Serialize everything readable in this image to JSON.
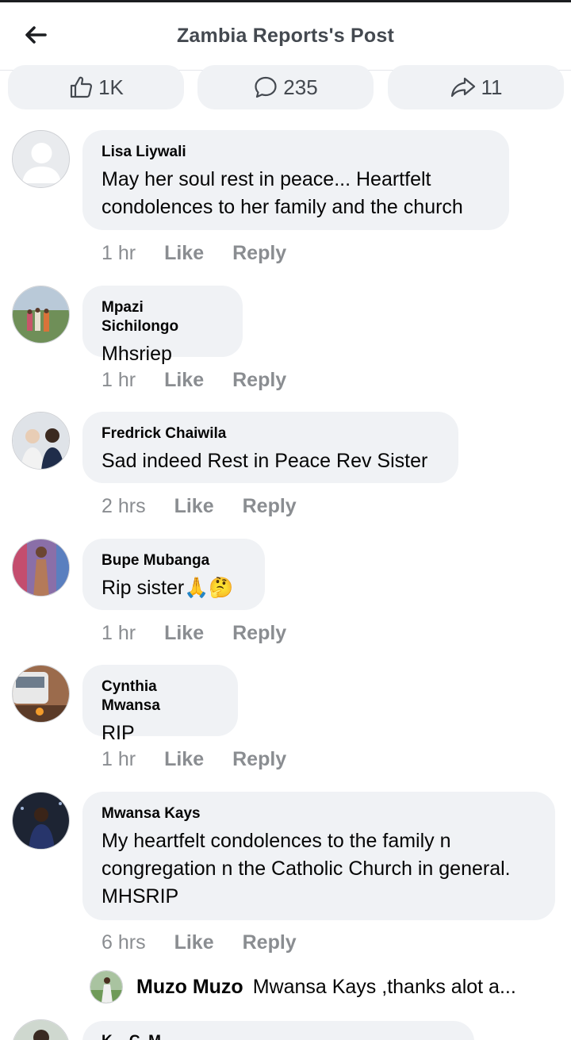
{
  "header": {
    "title": "Zambia Reports's Post",
    "back_icon": "arrow-left-icon"
  },
  "stats": {
    "likes": "1K",
    "comments": "235",
    "shares": "11",
    "like_icon": "thumbs-up-icon",
    "comment_icon": "comment-bubble-icon",
    "share_icon": "share-arrow-icon"
  },
  "actions": {
    "like": "Like",
    "reply": "Reply"
  },
  "comments": [
    {
      "name": "Lisa Liywali",
      "text": "May her soul rest in peace... Heartfelt\ncondolences to her family and the church",
      "time": "1 hr"
    },
    {
      "name": "Mpazi Sichilongo",
      "text": "Mhsriep",
      "time": "1 hr"
    },
    {
      "name": "Fredrick Chaiwila",
      "text": "Sad indeed Rest in Peace Rev Sister",
      "time": "2 hrs"
    },
    {
      "name": "Bupe Mubanga",
      "text": "Rip sister",
      "emoji": "🙏🤔",
      "time": "1 hr"
    },
    {
      "name": "Cynthia Mwansa",
      "text": "RIP",
      "time": "1 hr"
    },
    {
      "name": "Mwansa Kays",
      "text": "My heartfelt condolences to the family n\ncongregation n the Catholic Church in general.\nMHSRIP",
      "time": "6 hrs"
    }
  ],
  "reply_preview": {
    "name": "Muzo Muzo",
    "text": "Mwansa Kays ,thanks alot a..."
  },
  "peek_comment": {
    "name": "K... C. M..."
  }
}
